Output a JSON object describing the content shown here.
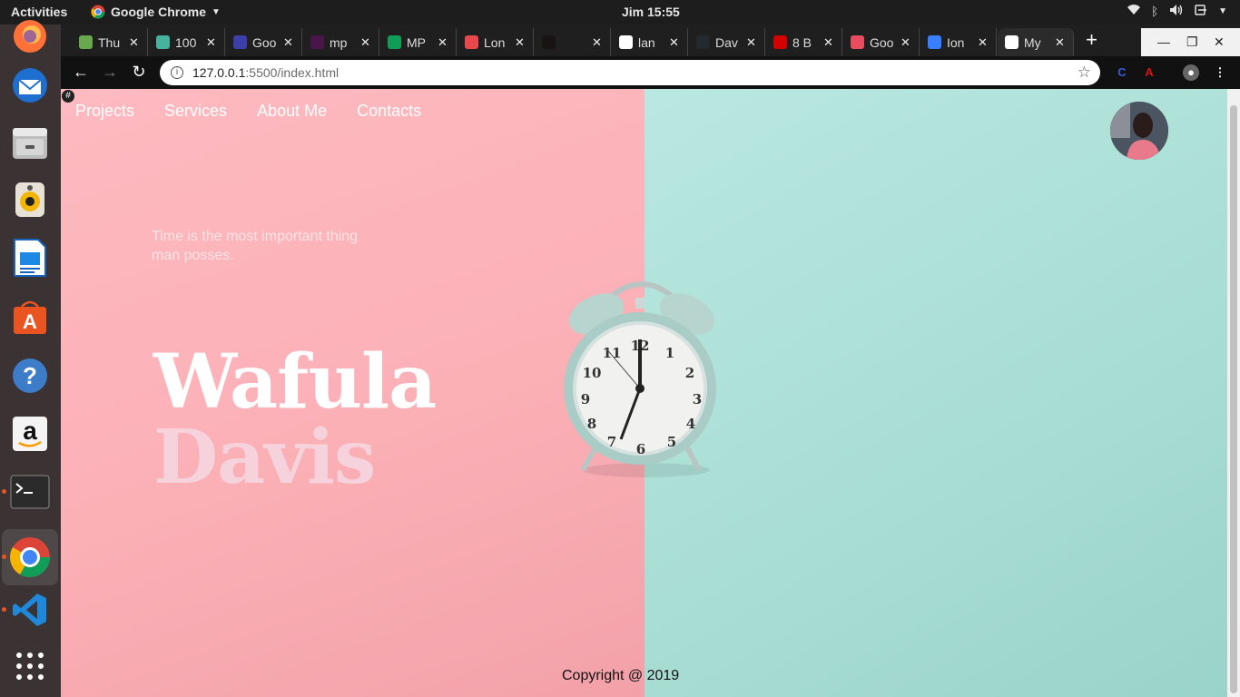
{
  "system": {
    "activities": "Activities",
    "app_name": "Google Chrome",
    "clock": "Jim 15:55"
  },
  "tabs": [
    {
      "title": "Thu",
      "color": "#6aa84f"
    },
    {
      "title": "100",
      "color": "#45b39d"
    },
    {
      "title": "Goo",
      "color": "#3c3fa8"
    },
    {
      "title": "mp",
      "color": "#4a154b"
    },
    {
      "title": "MP",
      "color": "#0f9d58"
    },
    {
      "title": "Lon",
      "color": "#e8474c"
    },
    {
      "title": "",
      "color": "#191414"
    },
    {
      "title": "lan",
      "color": "#ffffff"
    },
    {
      "title": "Dav",
      "color": "#24292e"
    },
    {
      "title": "8 B",
      "color": "#d50000"
    },
    {
      "title": "Goo",
      "color": "#e94c5f"
    },
    {
      "title": "Ion",
      "color": "#3880ff"
    },
    {
      "title": "My",
      "color": "#ffffff"
    }
  ],
  "browser": {
    "url_host": "127.0.0.1",
    "url_path": ":5500/index.html"
  },
  "site": {
    "nav": [
      "Projects",
      "Services",
      "About Me",
      "Contacts"
    ],
    "tagline": "Time is the most important thing man posses.",
    "first_name": "Wafula",
    "last_name": "Davis",
    "copyright": "Copyright @ 2019",
    "colors": {
      "pink": "#fbb0b6",
      "teal": "#a8ddd3"
    }
  }
}
